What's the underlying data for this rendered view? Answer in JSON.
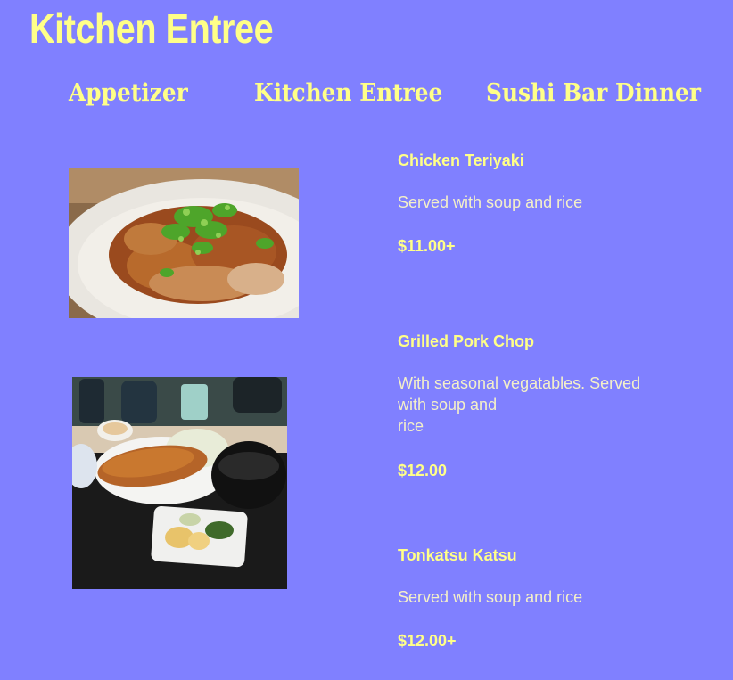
{
  "page": {
    "title": "Kitchen Entree"
  },
  "tabs": [
    {
      "label": "Appetizer"
    },
    {
      "label": "Kitchen Entree"
    },
    {
      "label": "Sushi Bar Dinner"
    }
  ],
  "menu": {
    "items": [
      {
        "name": "Chicken Teriyaki",
        "description": "Served with soup and rice",
        "price": "$11.00+"
      },
      {
        "name": "Grilled Pork Chop",
        "description_lines": [
          "With seasonal vegatables. Served",
          "with soup and",
          "rice"
        ],
        "price": "$12.00"
      },
      {
        "name": "Tonkatsu Katsu",
        "description": "Served with soup and rice",
        "price": "$12.00+"
      }
    ],
    "images": [
      {
        "icon": "chicken-teriyaki-photo"
      },
      {
        "icon": "pork-cutlet-set-photo"
      }
    ]
  },
  "colors": {
    "background": "#8080ff",
    "accent": "#ffff88"
  }
}
